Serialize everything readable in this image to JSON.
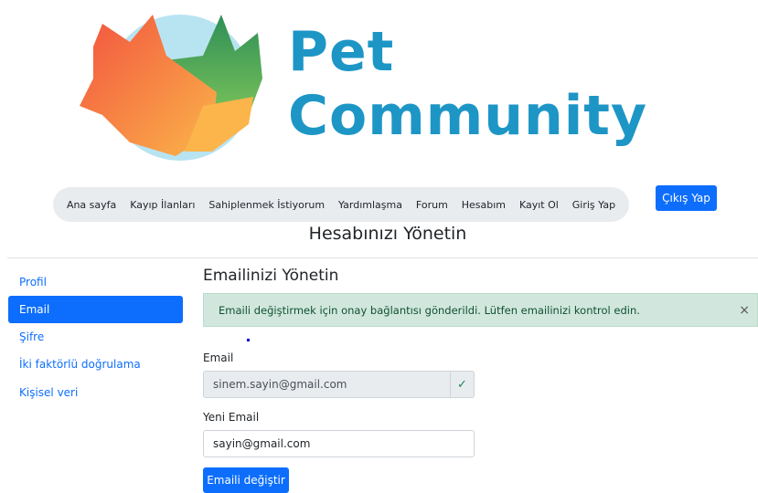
{
  "brand": {
    "name": "Pet Community"
  },
  "nav": {
    "items": [
      "Ana sayfa",
      "Kayıp İlanları",
      "Sahiplenmek İstiyorum",
      "Yardımlaşma",
      "Forum",
      "Hesabım",
      "Kayıt Ol",
      "Giriş Yap"
    ],
    "logout_label": "Çıkış Yap"
  },
  "page": {
    "title": "Hesabınızı Yönetin"
  },
  "sidebar": {
    "items": [
      {
        "label": "Profil",
        "active": false
      },
      {
        "label": "Email",
        "active": true
      },
      {
        "label": "Şifre",
        "active": false
      },
      {
        "label": "İki faktörlü doğrulama",
        "active": false
      },
      {
        "label": "Kişisel veri",
        "active": false
      }
    ]
  },
  "main": {
    "section_title": "Emailinizi Yönetin",
    "alert": {
      "text": "Emaili değiştirmek için onay bağlantısı gönderildi. Lütfen emailinizi kontrol edin.",
      "close": "×"
    },
    "email_label": "Email",
    "email_value": "sinem.sayin@gmail.com",
    "email_verified_icon": "✓",
    "new_email_label": "Yeni Email",
    "new_email_value": "sayin@gmail.com",
    "change_button": "Emaili değiştir"
  },
  "colors": {
    "primary": "#0d6efd",
    "brand_text": "#1d96c6",
    "alert_bg": "#d1e7dd"
  }
}
